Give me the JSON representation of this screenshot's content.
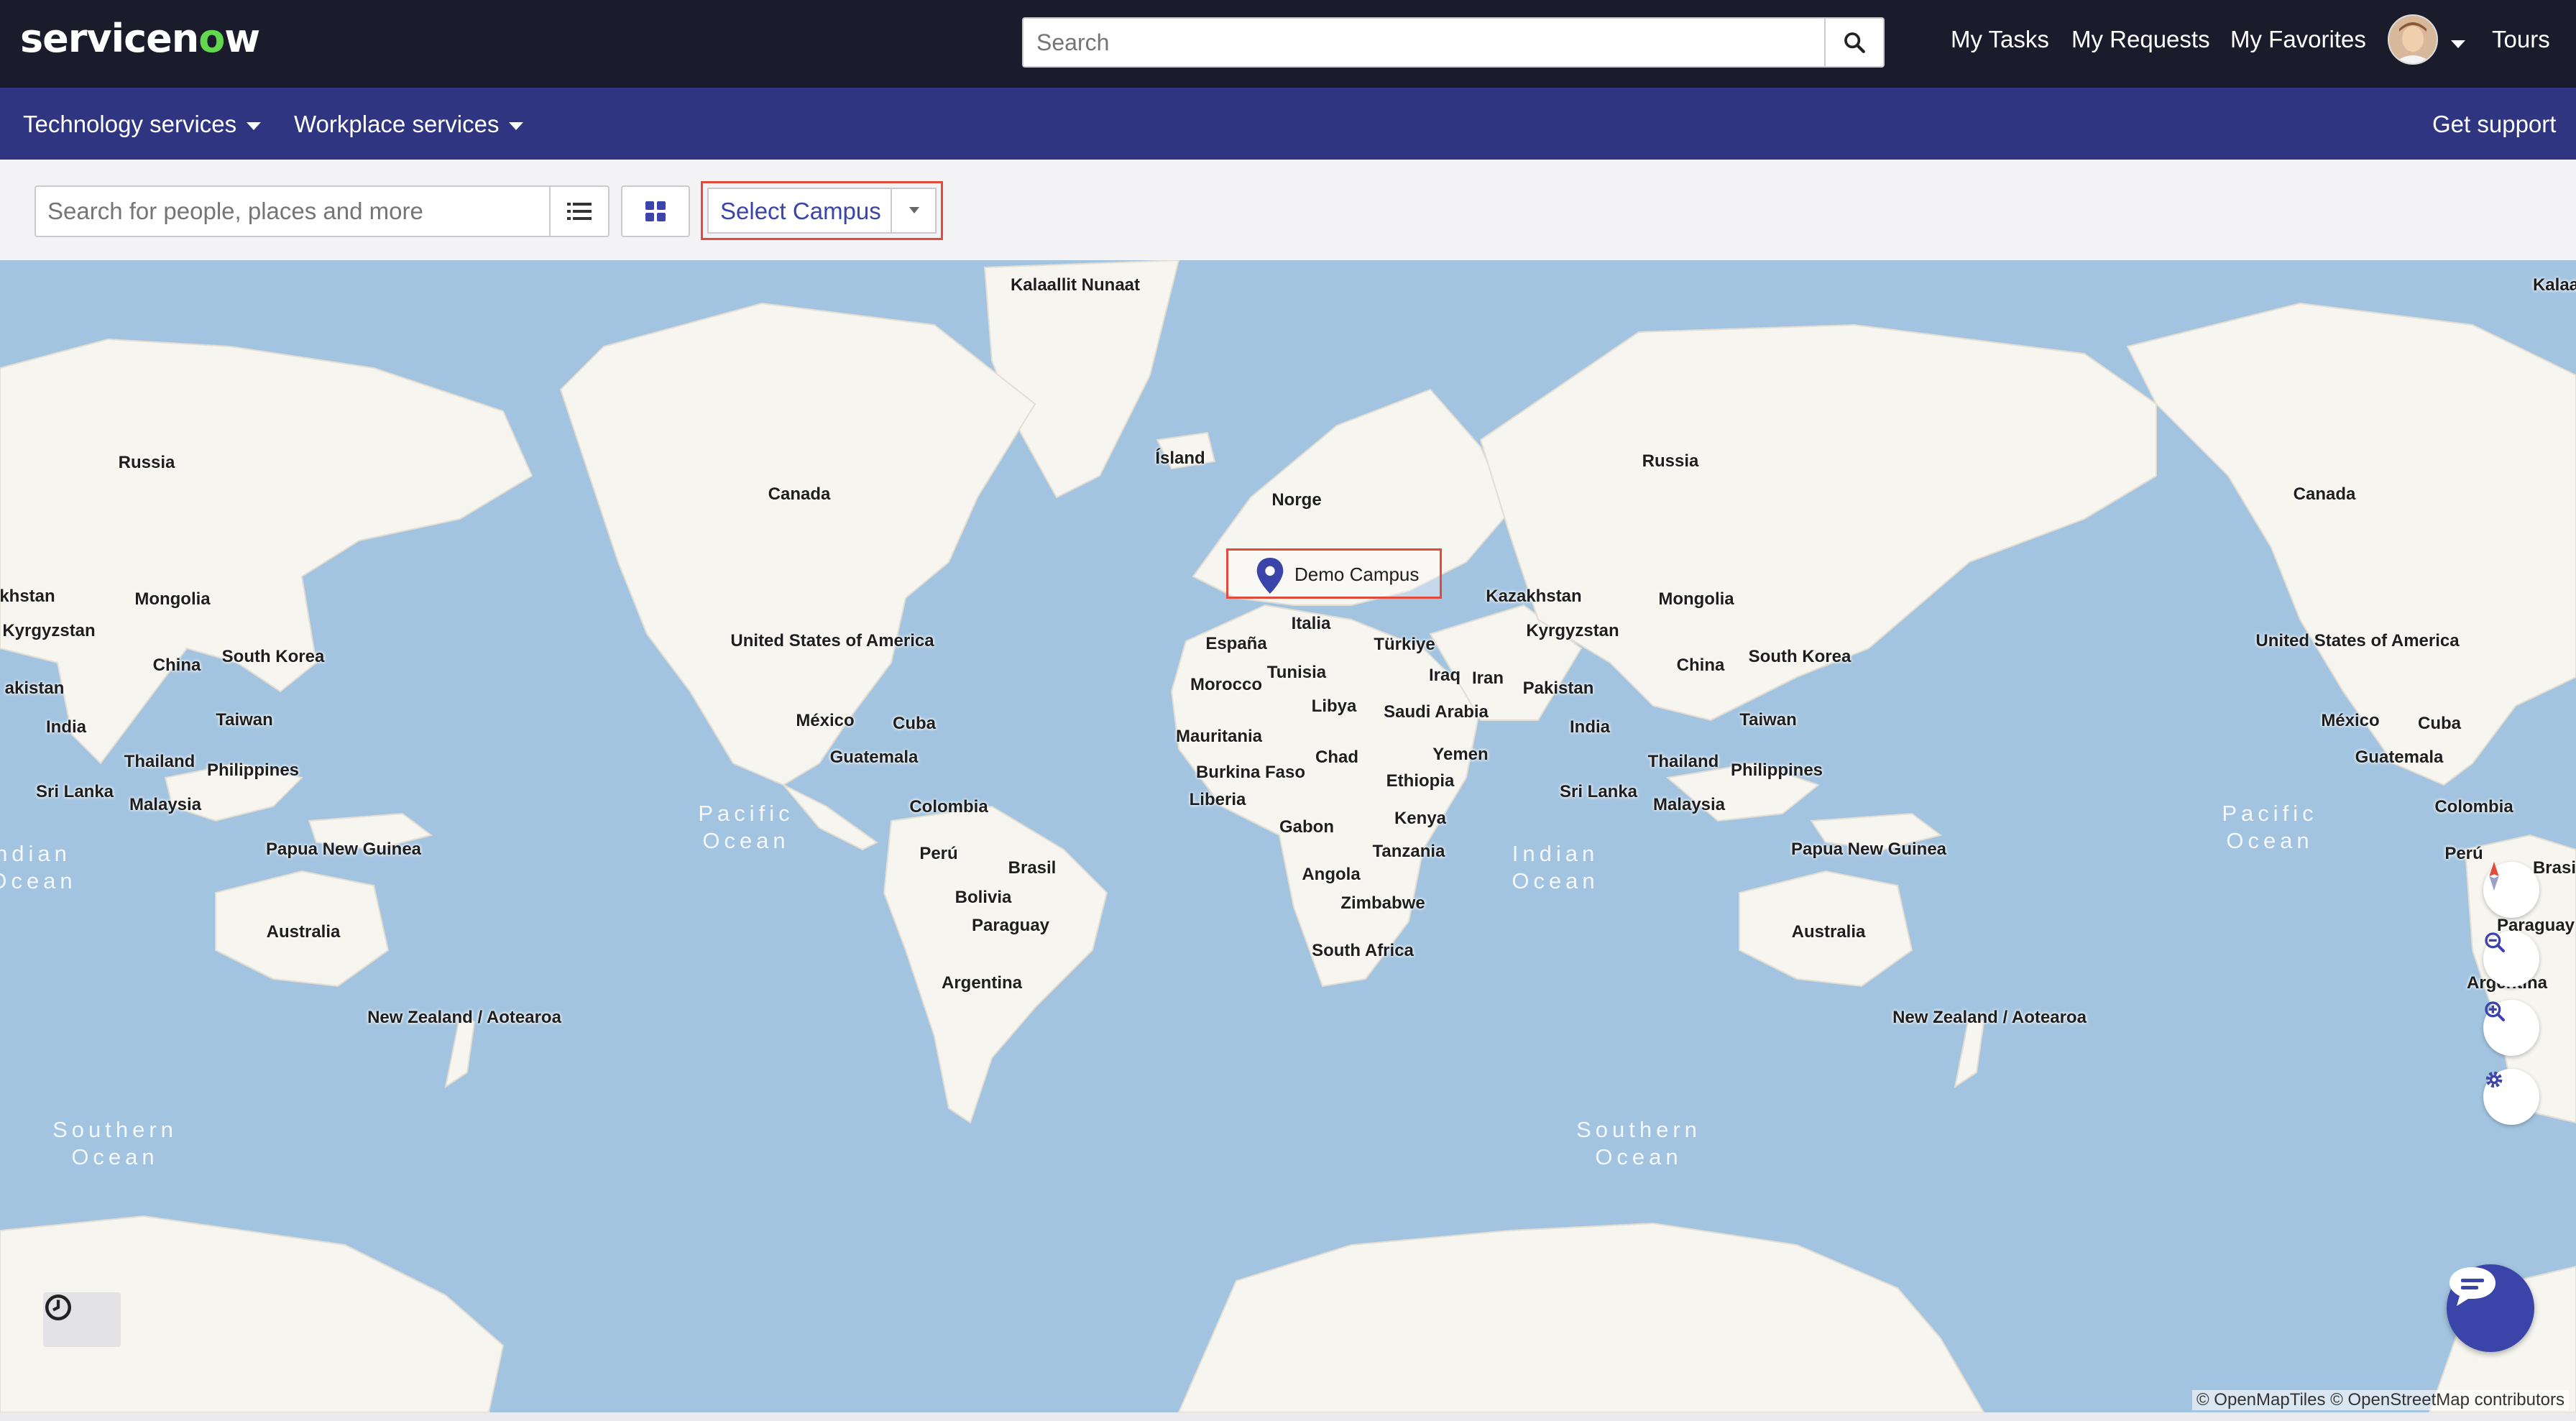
{
  "header": {
    "logo_text": "servicenow",
    "search_placeholder": "Search",
    "nav": [
      "My Tasks",
      "My Requests",
      "My Favorites",
      "Tours"
    ]
  },
  "subnav": {
    "items": [
      "Technology services",
      "Workplace services"
    ],
    "right": "Get support"
  },
  "toolbar": {
    "people_search_placeholder": "Search for people, places and more",
    "campus_select": "Select Campus"
  },
  "map": {
    "marker_label": "Demo Campus",
    "attribution": "© OpenMapTiles © OpenStreetMap contributors",
    "labels_left": {
      "russia": "Russia",
      "kazakhstan": "khstan",
      "mongolia": "Mongolia",
      "kyrgyzstan": "Kyrgyzstan",
      "china": "China",
      "south_korea": "South Korea",
      "pakistan": "akistan",
      "india": "India",
      "taiwan": "Taiwan",
      "thailand": "Thailand",
      "philippines": "Philippines",
      "sri_lanka": "Sri Lanka",
      "malaysia": "Malaysia",
      "indian_ocean": "ndian\nOcean",
      "papua": "Papua New Guinea",
      "australia": "Australia",
      "new_zealand": "New Zealand\n/ Aotearoa",
      "southern_ocean": "Southern\nOcean"
    },
    "labels_mid": {
      "greenland": "Kalaallit Nunaat",
      "iceland": "Ísland",
      "canada": "Canada",
      "usa": "United States\nof America",
      "mexico": "México",
      "cuba": "Cuba",
      "guatemala": "Guatemala",
      "colombia": "Colombia",
      "pacific_ocean": "Pacific\nOcean",
      "peru": "Perú",
      "brasil": "Brasil",
      "bolivia": "Bolivia",
      "paraguay": "Paraguay",
      "argentina": "Argentina",
      "norge": "Norge",
      "espana": "España",
      "italia": "Italia",
      "turkiye": "Türkiye",
      "morocco": "Morocco",
      "tunisia": "Tunisia",
      "iraq": "Iraq",
      "iran": "Iran",
      "libya": "Libya",
      "saudi": "Saudi Arabia",
      "mauritania": "Mauritania",
      "chad": "Chad",
      "yemen": "Yemen",
      "burkina": "Burkina Faso",
      "ethiopia": "Ethiopia",
      "liberia": "Liberia",
      "kenya": "Kenya",
      "gabon": "Gabon",
      "tanzania": "Tanzania",
      "angola": "Angola",
      "zimbabwe": "Zimbabwe",
      "south_africa": "South Africa"
    },
    "labels_right": {
      "russia": "Russia",
      "kazakhstan": "Kazakhstan",
      "mongolia": "Mongolia",
      "kyrgyzstan": "Kyrgyzstan",
      "pakistan": "Pakistan",
      "china": "China",
      "south_korea": "South Korea",
      "india": "India",
      "taiwan": "Taiwan",
      "thailand": "Thailand",
      "philippines": "Philippines",
      "sri_lanka": "Sri Lanka",
      "malaysia": "Malaysia",
      "indian_ocean": "Indian\nOcean",
      "papua": "Papua New Guinea",
      "australia": "Australia",
      "new_zealand": "New Zealand\n/ Aotearoa",
      "southern_ocean": "Southern\nOcean",
      "greenland": "Kalaa",
      "canada": "Canada",
      "usa": "United States\nof America",
      "mexico": "México",
      "cuba": "Cuba",
      "guatemala": "Guatemala",
      "pacific_ocean": "Pacific\nOcean",
      "colombia": "Colombia",
      "peru": "Perú",
      "brasil": "Brasi",
      "paraguay": "Paraguay",
      "argentina": "Argentina"
    }
  },
  "colors": {
    "header_bg": "#1b1c2b",
    "subnav_bg": "#2f3581",
    "accent": "#3b44a8",
    "highlight": "#e04b3c",
    "water": "#a3c4e0",
    "land": "#f7f5f0"
  }
}
